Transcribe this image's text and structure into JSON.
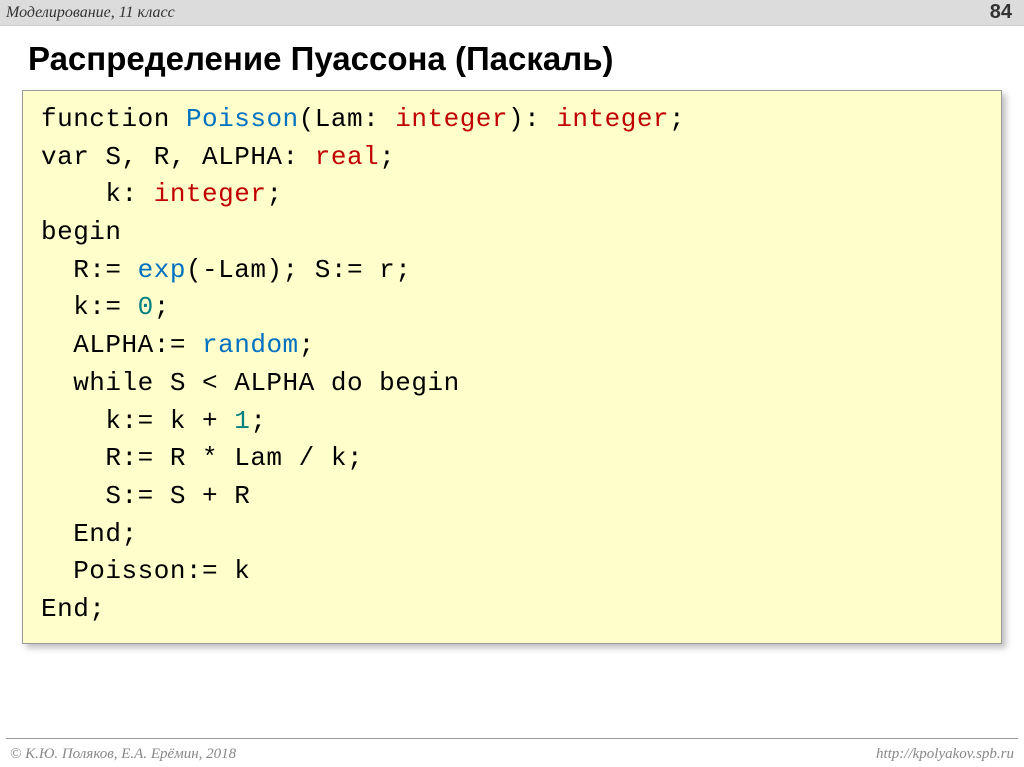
{
  "header": {
    "left": "Моделирование, 11 класс",
    "pageNumber": "84"
  },
  "title": "Распределение Пуассона (Паскаль)",
  "code": {
    "line1_a": "function ",
    "line1_b": "Poisson",
    "line1_c": "(Lam: ",
    "line1_d": "integer",
    "line1_e": "): ",
    "line1_f": "integer",
    "line1_g": ";",
    "line2_a": "var S, R, ALPHA: ",
    "line2_b": "real",
    "line2_c": ";",
    "line3_a": "    k: ",
    "line3_b": "integer",
    "line3_c": ";",
    "line4": "begin",
    "line5_a": "  R:= ",
    "line5_b": "exp",
    "line5_c": "(-Lam); S:= r;",
    "line6_a": "  k:= ",
    "line6_b": "0",
    "line6_c": ";",
    "line7_a": "  ALPHA:= ",
    "line7_b": "random",
    "line7_c": ";",
    "line8": "  while S < ALPHA do begin",
    "line9_a": "    k:= k + ",
    "line9_b": "1",
    "line9_c": ";",
    "line10": "    R:= R * Lam / k;",
    "line11": "    S:= S + R",
    "line12": "  End;",
    "line13": "  Poisson:= k",
    "line14": "End;"
  },
  "footer": {
    "left": "© К.Ю. Поляков, Е.А. Ерёмин, 2018",
    "right": "http://kpolyakov.spb.ru"
  }
}
